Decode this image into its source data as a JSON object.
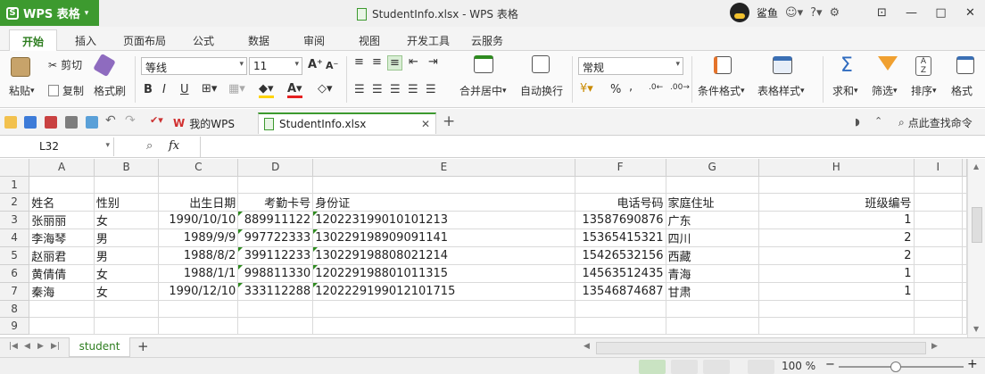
{
  "app": {
    "menu_label": "WPS 表格",
    "logo_glyph": "S"
  },
  "window": {
    "title": "StudentInfo.xlsx - WPS 表格",
    "user_name": "鲨鱼"
  },
  "ribbon_tabs": [
    "开始",
    "插入",
    "页面布局",
    "公式",
    "数据",
    "审阅",
    "视图",
    "开发工具",
    "云服务"
  ],
  "ribbon": {
    "paste": "粘贴",
    "cut": "剪切",
    "copy": "复制",
    "format_painter": "格式刷",
    "font_name": "等线",
    "font_size": "11",
    "merge_center": "合并居中",
    "wrap_text": "自动换行",
    "number_format": "常规",
    "percent": "%",
    "conditional_format": "条件格式",
    "table_style": "表格样式",
    "sum": "求和",
    "filter": "筛选",
    "sort": "排序",
    "format": "格式"
  },
  "doc_tabs": {
    "home": "我的WPS",
    "active": "StudentInfo.xlsx",
    "search": "点此查找命令"
  },
  "formula_bar": {
    "cell_ref": "L32",
    "fx": "fx",
    "content": ""
  },
  "grid": {
    "columns": [
      "A",
      "B",
      "C",
      "D",
      "E",
      "F",
      "G",
      "H",
      "I"
    ],
    "rows": [
      {
        "n": "1",
        "cells": [
          "",
          "",
          "",
          "",
          "",
          "",
          "",
          "",
          ""
        ]
      },
      {
        "n": "2",
        "cells": [
          "姓名",
          "性别",
          "出生日期",
          "考勤卡号",
          "身份证",
          "电话号码",
          "家庭住址",
          "班级编号",
          ""
        ]
      },
      {
        "n": "3",
        "cells": [
          "张丽丽",
          "女",
          "1990/10/10",
          "889911122",
          "120223199010101213",
          "13587690876",
          "广东",
          "1",
          ""
        ]
      },
      {
        "n": "4",
        "cells": [
          "李海琴",
          "男",
          "1989/9/9",
          "997722333",
          "130229198909091141",
          "15365415321",
          "四川",
          "2",
          ""
        ]
      },
      {
        "n": "5",
        "cells": [
          "赵丽君",
          "男",
          "1988/8/2",
          "399112233",
          "130229198808021214",
          "15426532156",
          "西藏",
          "2",
          ""
        ]
      },
      {
        "n": "6",
        "cells": [
          "黄倩倩",
          "女",
          "1988/1/1",
          "998811330",
          "120229198801011315",
          "14563512435",
          "青海",
          "1",
          ""
        ]
      },
      {
        "n": "7",
        "cells": [
          "秦海",
          "女",
          "1990/12/10",
          "333112288",
          "1202229199012101715",
          "13546874687",
          "甘肃",
          "1",
          ""
        ]
      },
      {
        "n": "8",
        "cells": [
          "",
          "",
          "",
          "",
          "",
          "",
          "",
          "",
          ""
        ]
      },
      {
        "n": "9",
        "cells": [
          "",
          "",
          "",
          "",
          "",
          "",
          "",
          "",
          ""
        ]
      }
    ]
  },
  "sheet_tabs": {
    "active": "student",
    "add": "+"
  },
  "status": {
    "zoom": "100 %",
    "zoom_minus": "−",
    "zoom_plus": "+"
  }
}
